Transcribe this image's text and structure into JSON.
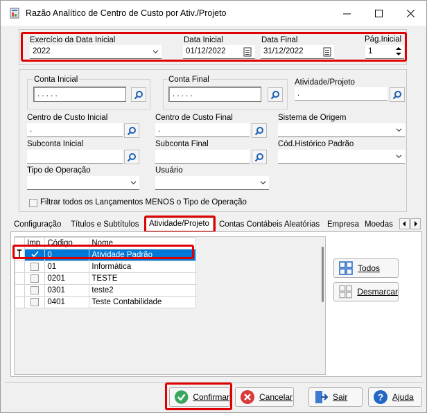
{
  "window": {
    "title": "Razão Analítico de Centro de Custo por Ativ./Projeto"
  },
  "top": {
    "exercicio_label": "Exercício da Data Inicial",
    "exercicio_value": "2022",
    "data_inicial_label": "Data Inicial",
    "data_inicial_value": "01/12/2022",
    "data_final_label": "Data Final",
    "data_final_value": "31/12/2022",
    "pag_inicial_label": "Pág.Inicial",
    "pag_inicial_value": "1"
  },
  "filters": {
    "conta_inicial_label": "Conta Inicial",
    "conta_inicial_value": ". . . . .",
    "conta_final_label": "Conta Final",
    "conta_final_value": ". . . . .",
    "atividade_label": "Atividade/Projeto",
    "atividade_value": ".",
    "cc_inicial_label": "Centro de Custo Inicial",
    "cc_inicial_value": ".",
    "cc_final_label": "Centro de Custo Final",
    "cc_final_value": ".",
    "sistema_label": "Sistema de Origem",
    "sistema_value": "",
    "subconta_inicial_label": "Subconta Inicial",
    "subconta_inicial_value": "",
    "subconta_final_label": "Subconta Final",
    "subconta_final_value": "",
    "historico_label": "Cód.Histórico Padrão",
    "historico_value": "",
    "tipo_operacao_label": "Tipo de Operação",
    "tipo_operacao_value": "",
    "usuario_label": "Usuário",
    "usuario_value": "",
    "filtrar_label": "Filtrar todos os Lançamentos MENOS o Tipo de Operação"
  },
  "tabs": [
    "Configuração",
    "Títulos e Subtítulos",
    "Atividade/Projeto",
    "Contas Contábeis Aleatórias",
    "Empresa",
    "Moedas"
  ],
  "grid": {
    "headers": [
      "Imp.",
      "Código",
      "Nome"
    ],
    "rows": [
      {
        "checked": true,
        "codigo": "0",
        "nome": "Atividade Padrão"
      },
      {
        "checked": false,
        "codigo": "01",
        "nome": "Informática"
      },
      {
        "checked": false,
        "codigo": "0201",
        "nome": "TESTE"
      },
      {
        "checked": false,
        "codigo": "0301",
        "nome": "teste2"
      },
      {
        "checked": false,
        "codigo": "0401",
        "nome": "Teste Contabilidade"
      }
    ]
  },
  "side_buttons": {
    "todos": "Todos",
    "desmarcar": "Desmarcar"
  },
  "footer": {
    "confirmar": "Confirmar",
    "cancelar": "Cancelar",
    "sair": "Sair",
    "ajuda": "Ajuda"
  },
  "colors": {
    "highlight": "#e00000",
    "selection": "#0078d7"
  }
}
